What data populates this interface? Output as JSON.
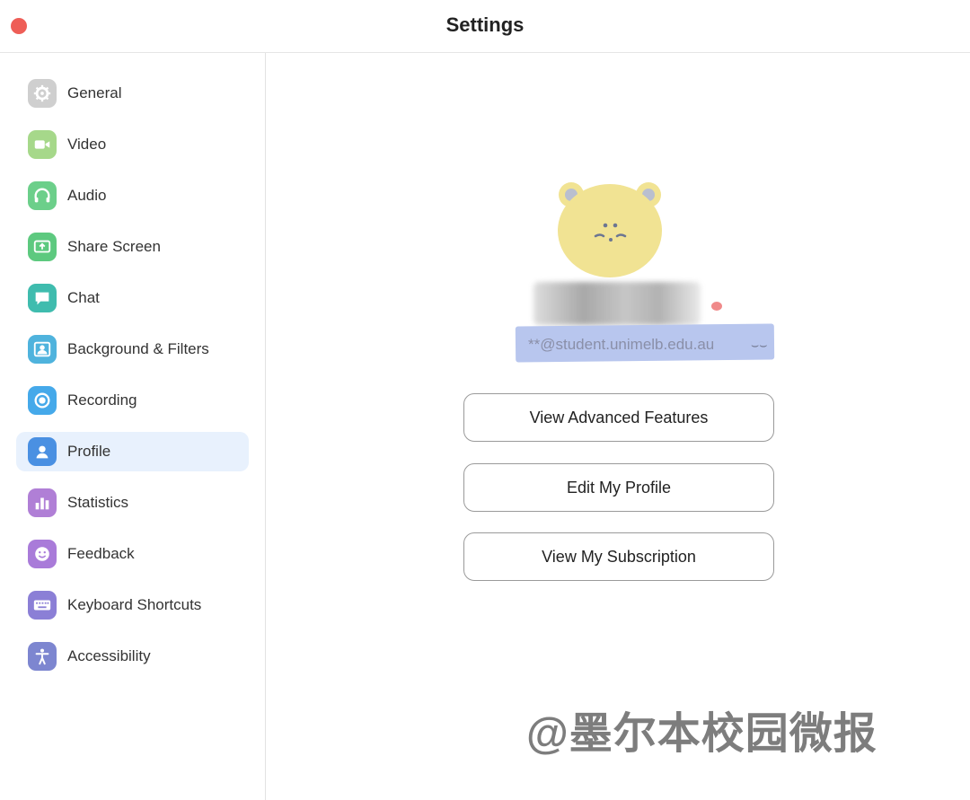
{
  "window": {
    "title": "Settings"
  },
  "sidebar": {
    "items": [
      {
        "label": "General",
        "icon": "gear-icon",
        "color": "#c8c8c8"
      },
      {
        "label": "Video",
        "icon": "video-camera-icon",
        "color": "#a6d88a"
      },
      {
        "label": "Audio",
        "icon": "headphones-icon",
        "color": "#6ccf8a"
      },
      {
        "label": "Share Screen",
        "icon": "share-screen-icon",
        "color": "#5dc97f"
      },
      {
        "label": "Chat",
        "icon": "chat-bubble-icon",
        "color": "#3fbcae"
      },
      {
        "label": "Background & Filters",
        "icon": "person-portrait-icon",
        "color": "#4fb3dd"
      },
      {
        "label": "Recording",
        "icon": "record-icon",
        "color": "#45a9ea"
      },
      {
        "label": "Profile",
        "icon": "person-icon",
        "color": "#4a90e2",
        "active": true
      },
      {
        "label": "Statistics",
        "icon": "bar-chart-icon",
        "color": "#b07fd6"
      },
      {
        "label": "Feedback",
        "icon": "smiley-icon",
        "color": "#a97bd9"
      },
      {
        "label": "Keyboard Shortcuts",
        "icon": "keyboard-icon",
        "color": "#8b7fd6"
      },
      {
        "label": "Accessibility",
        "icon": "accessibility-icon",
        "color": "#7d86d0"
      }
    ]
  },
  "profile": {
    "email": "**@student.unimelb.edu.au",
    "buttons": {
      "advanced": "View Advanced Features",
      "edit": "Edit My Profile",
      "subscription": "View My Subscription"
    }
  },
  "watermark": "@墨尔本校园微报",
  "colors": {
    "close_button": "#ee5e57",
    "active_nav_bg": "#e8f1fd",
    "avatar_yellow": "#f1e393",
    "email_highlight": "#b8c6ee"
  }
}
